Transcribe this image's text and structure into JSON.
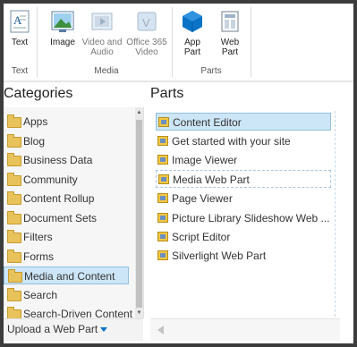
{
  "ribbon": {
    "text_group": {
      "label": "Text",
      "buttons": [
        {
          "label": "Text"
        }
      ]
    },
    "media_group": {
      "label": "Media",
      "buttons": [
        {
          "label": "Image"
        },
        {
          "label": "Video and Audio"
        },
        {
          "label": "Office 365 Video"
        }
      ]
    },
    "parts_group": {
      "label": "Parts",
      "buttons": [
        {
          "label": "App Part"
        },
        {
          "label": "Web Part"
        }
      ]
    }
  },
  "categories": {
    "title": "Categories",
    "items": [
      {
        "label": "Apps"
      },
      {
        "label": "Blog"
      },
      {
        "label": "Business Data"
      },
      {
        "label": "Community"
      },
      {
        "label": "Content Rollup"
      },
      {
        "label": "Document Sets"
      },
      {
        "label": "Filters"
      },
      {
        "label": "Forms"
      },
      {
        "label": "Media and Content"
      },
      {
        "label": "Search"
      },
      {
        "label": "Search-Driven Content"
      }
    ],
    "selected": "Media and Content",
    "upload_label": "Upload a Web Part"
  },
  "parts": {
    "title": "Parts",
    "items": [
      {
        "label": "Content Editor"
      },
      {
        "label": "Get started with your site"
      },
      {
        "label": "Image Viewer"
      },
      {
        "label": "Media Web Part"
      },
      {
        "label": "Page Viewer"
      },
      {
        "label": "Picture Library Slideshow Web ..."
      },
      {
        "label": "Script Editor"
      },
      {
        "label": "Silverlight Web Part"
      }
    ],
    "selected": "Content Editor"
  },
  "colors": {
    "accent": "#0072c6",
    "selection": "#cde6f7"
  }
}
